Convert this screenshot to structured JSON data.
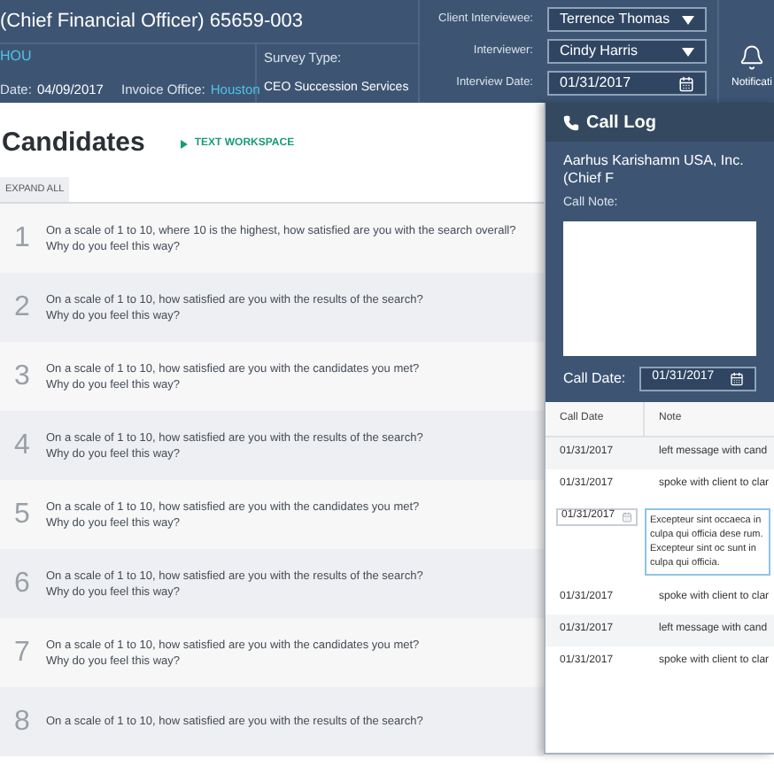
{
  "header": {
    "title": "(Chief Financial Officer)  65659-003",
    "office_code": "HOU",
    "date_label": "Date:",
    "date": "04/09/2017",
    "invoice_label": "Invoice Office:",
    "invoice_office": "Houston",
    "survey_label": "Survey Type:",
    "survey_type": "CEO Succession Services",
    "fields": [
      {
        "label": "Client Interviewee:",
        "value": "Terrence Thomas",
        "kind": "dropdown"
      },
      {
        "label": "Interviewer:",
        "value": "Cindy Harris",
        "kind": "dropdown"
      },
      {
        "label": "Interview Date:",
        "value": "01/31/2017",
        "kind": "date"
      }
    ],
    "notifications": "Notificati"
  },
  "page": {
    "title": "Candidates",
    "workspace_link": "TEXT WORKSPACE",
    "expand_all": "EXPAND ALL"
  },
  "questions": [
    {
      "number": "1",
      "lines": [
        "On a scale of 1 to 10, where 10 is the highest, how satisfied are you with the search overall?",
        "Why do you feel this way?"
      ]
    },
    {
      "number": "2",
      "lines": [
        "On a scale of 1 to 10, how satisfied are you with the results of the search?",
        "Why do you feel this way?"
      ]
    },
    {
      "number": "3",
      "lines": [
        "On a scale of 1 to 10, how satisfied are you with the candidates you met?",
        "Why do you feel this way?"
      ]
    },
    {
      "number": "4",
      "lines": [
        "On a scale of 1 to 10, how satisfied are you with the results of the search?",
        "Why do you feel this way?"
      ]
    },
    {
      "number": "5",
      "lines": [
        "On a scale of 1 to 10, how satisfied are you with the candidates you met?",
        "Why do you feel this way?"
      ]
    },
    {
      "number": "6",
      "lines": [
        "On a scale of 1 to 10, how satisfied are you with the results of the search?",
        "Why do you feel this way?"
      ]
    },
    {
      "number": "7",
      "lines": [
        "On a scale of 1 to 10, how satisfied are you with the candidates you met?",
        "Why do you feel this way?"
      ]
    },
    {
      "number": "8",
      "lines": [
        "On a scale of 1 to 10, how satisfied are you with the results of the search?"
      ]
    }
  ],
  "call_log": {
    "title": "Call Log",
    "company": "Aarhus Karishamn USA, Inc. (Chief F",
    "note_label": "Call Note:",
    "date_label": "Call Date:",
    "date": "01/31/2017",
    "columns": [
      "Call Date",
      "Note"
    ],
    "calls": [
      {
        "kind": "row",
        "date": "01/31/2017",
        "note": "left message with cand"
      },
      {
        "kind": "row",
        "date": "01/31/2017",
        "note": "spoke with client to clar"
      },
      {
        "kind": "editing",
        "date": "01/31/2017",
        "note": "Excepteur sint occaeca in culpa qui officia dese rum.  Excepteur sint oc sunt in culpa qui officia."
      },
      {
        "kind": "row",
        "date": "01/31/2017",
        "note": "spoke with client to clar"
      },
      {
        "kind": "row",
        "date": "01/31/2017",
        "note": "left message with cand"
      },
      {
        "kind": "row",
        "date": "01/31/2017",
        "note": "spoke with client to clar"
      }
    ]
  }
}
